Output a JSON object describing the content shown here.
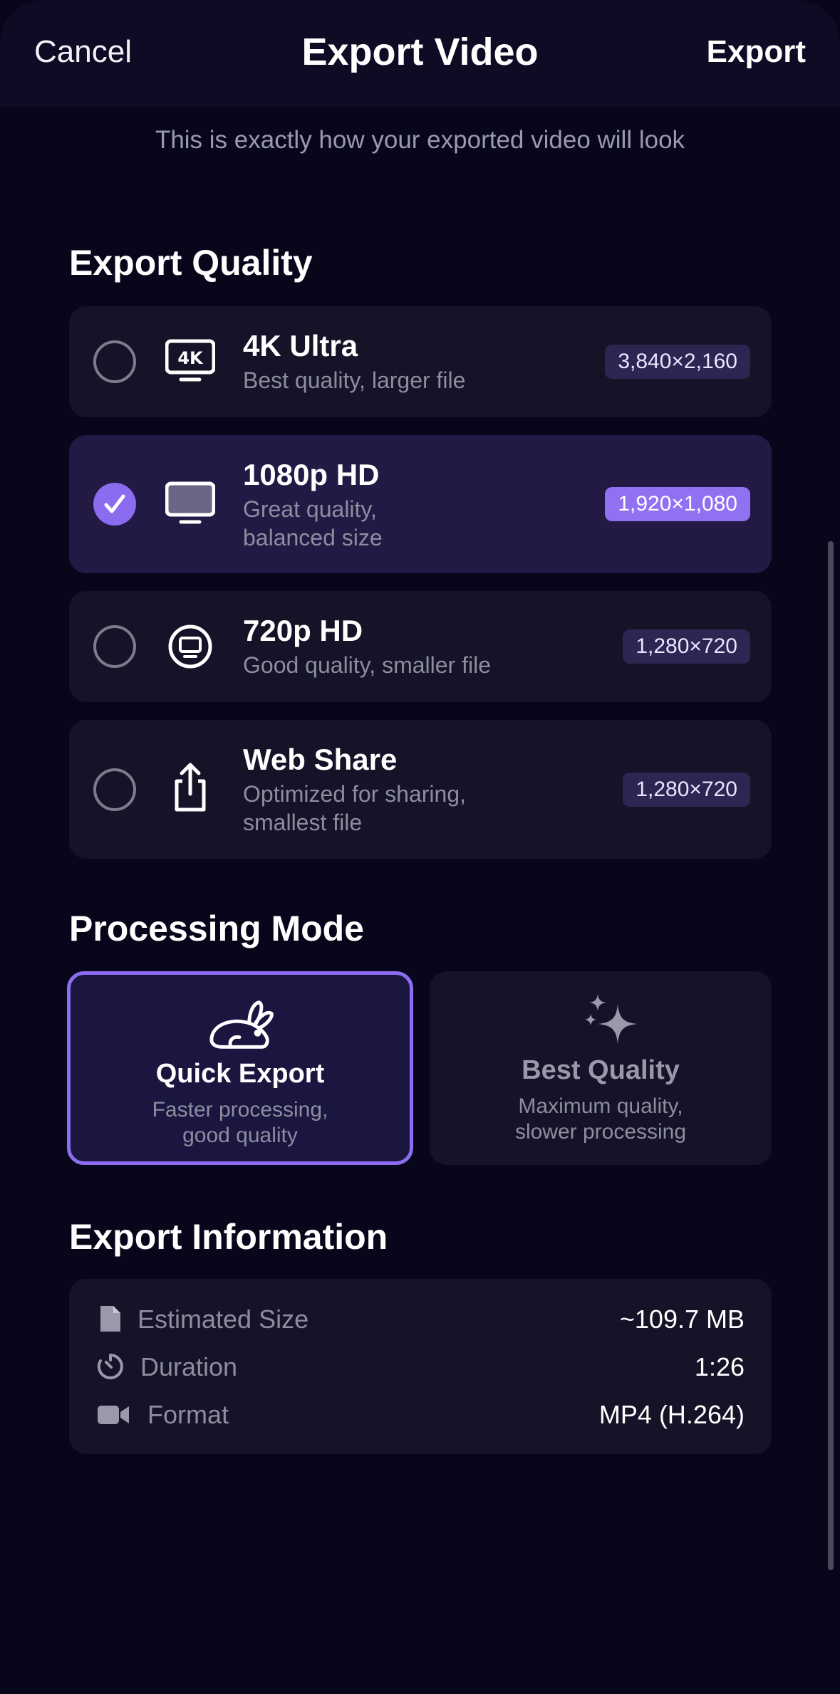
{
  "header": {
    "cancel_label": "Cancel",
    "title": "Export Video",
    "export_label": "Export"
  },
  "subtitle": "This is exactly how your exported video will look",
  "quality": {
    "section_title": "Export Quality",
    "options": [
      {
        "title": "4K Ultra",
        "desc_lines": [
          "Best quality, larger file"
        ],
        "resolution": "3,840×2,160",
        "selected": false,
        "icon": "4k-display-icon"
      },
      {
        "title": "1080p HD",
        "desc_lines": [
          "Great quality,",
          "balanced size"
        ],
        "resolution": "1,920×1,080",
        "selected": true,
        "icon": "monitor-icon"
      },
      {
        "title": "720p HD",
        "desc_lines": [
          "Good quality, smaller file"
        ],
        "resolution": "1,280×720",
        "selected": false,
        "icon": "tv-circle-icon"
      },
      {
        "title": "Web Share",
        "desc_lines": [
          "Optimized for sharing,",
          "smallest file"
        ],
        "resolution": "1,280×720",
        "selected": false,
        "icon": "share-icon"
      }
    ]
  },
  "processing": {
    "section_title": "Processing Mode",
    "modes": [
      {
        "title": "Quick Export",
        "desc_lines": [
          "Faster processing,",
          "good quality"
        ],
        "selected": true,
        "icon": "rabbit-icon"
      },
      {
        "title": "Best Quality",
        "desc_lines": [
          "Maximum quality,",
          "slower processing"
        ],
        "selected": false,
        "icon": "sparkles-icon"
      }
    ]
  },
  "info": {
    "section_title": "Export Information",
    "rows": [
      {
        "label": "Estimated Size",
        "value": "~109.7 MB",
        "icon": "document-icon"
      },
      {
        "label": "Duration",
        "value": "1:26",
        "icon": "timer-icon"
      },
      {
        "label": "Format",
        "value": "MP4 (H.264)",
        "icon": "video-camera-icon"
      }
    ]
  },
  "colors": {
    "background": "#07061a",
    "card": "#141327",
    "selected_card": "#221a45",
    "accent": "#8b6cf0"
  }
}
